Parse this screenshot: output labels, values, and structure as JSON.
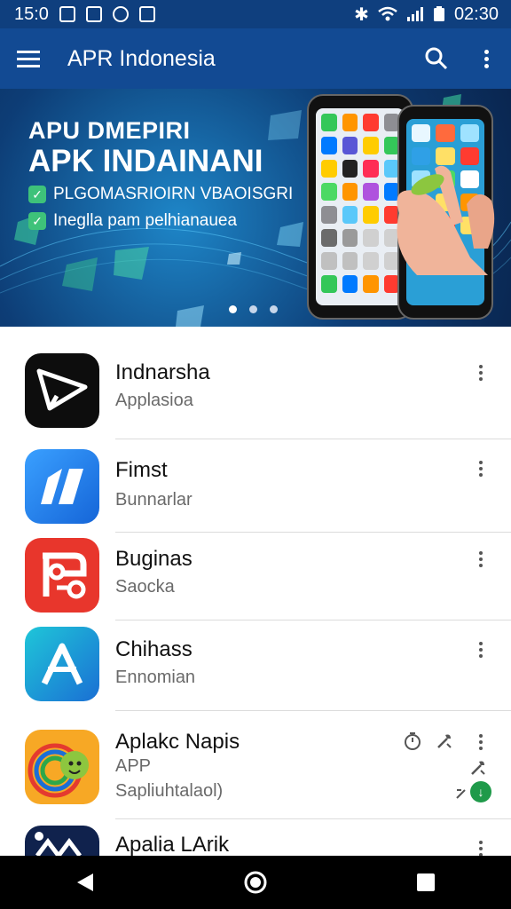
{
  "status_bar": {
    "time_left": "15:0",
    "time_right": "02:30",
    "icons_left": [
      "gallery-icon",
      "notification-icon",
      "app-icon",
      "youtube-icon"
    ],
    "icons_right": [
      "bluetooth-icon",
      "wifi-icon",
      "signal-icon",
      "battery-icon"
    ]
  },
  "app_bar": {
    "title": "APR Indonesia",
    "icons": [
      "menu-icon",
      "search-icon",
      "more-vert-icon"
    ]
  },
  "banner": {
    "headline_1": "APU DMEPIRI",
    "headline_2": "APK INDAINANI",
    "line_1": "PLGOMASRIOIRN VBAOISGRI",
    "line_2": "Ineglla pam pelhianauea",
    "dots_total": 3,
    "dots_active_index": 0
  },
  "apps": [
    {
      "name": "Indnarsha",
      "subtitle": "Applasioa",
      "extra": ""
    },
    {
      "name": "Fimst",
      "subtitle": "Bunnarlar",
      "extra": ""
    },
    {
      "name": "Buginas",
      "subtitle": "Saocka",
      "extra": ""
    },
    {
      "name": "Chihass",
      "subtitle": "Ennomian",
      "extra": ""
    },
    {
      "name": "Aplakc Napis",
      "subtitle": "APP",
      "extra": "Sapliuhtalaol)"
    },
    {
      "name": "Apalia LArik",
      "subtitle": "",
      "extra": ""
    }
  ],
  "colors": {
    "app_bar": "#124a93",
    "status_bar": "#0f3f7e",
    "accent_green": "#1f9a4a"
  },
  "nav_bar": {
    "icons": [
      "back-icon",
      "home-icon",
      "recents-icon"
    ]
  }
}
